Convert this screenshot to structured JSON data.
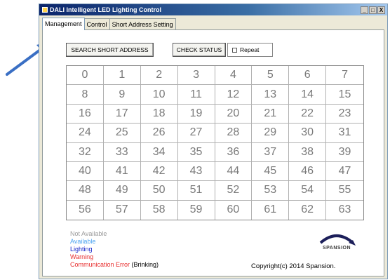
{
  "window": {
    "title": "DALI Intelligent LED Lighting Control",
    "controls": [
      "_",
      "□",
      "X"
    ]
  },
  "tabs": [
    {
      "label": "Management",
      "active": true
    },
    {
      "label": "Control",
      "active": false
    },
    {
      "label": "Short Address Setting",
      "active": false
    }
  ],
  "toolbar": {
    "search_label": "SEARCH SHORT ADDRESS",
    "check_label": "CHECK STATUS",
    "repeat_label": "Repeat",
    "repeat_checked": false
  },
  "grid": {
    "cells": [
      "0",
      "1",
      "2",
      "3",
      "4",
      "5",
      "6",
      "7",
      "8",
      "9",
      "10",
      "11",
      "12",
      "13",
      "14",
      "15",
      "16",
      "17",
      "18",
      "19",
      "20",
      "21",
      "22",
      "23",
      "24",
      "25",
      "26",
      "27",
      "28",
      "29",
      "30",
      "31",
      "32",
      "33",
      "34",
      "35",
      "36",
      "37",
      "38",
      "39",
      "40",
      "41",
      "42",
      "43",
      "44",
      "45",
      "46",
      "47",
      "48",
      "49",
      "50",
      "51",
      "52",
      "53",
      "54",
      "55",
      "56",
      "57",
      "58",
      "59",
      "60",
      "61",
      "62",
      "63"
    ]
  },
  "legend": {
    "not_available": "Not Available",
    "available": "Available",
    "lighting": "Lighting",
    "warning": "Warning",
    "comm_error": "Communication Error",
    "comm_error_note": "(Brinking)"
  },
  "colors": {
    "not_available": "#9a9a9a",
    "available": "#4aa3f0",
    "lighting": "#1020c8",
    "warning": "#e83030",
    "comm_error": "#e83030",
    "arrow": "#3a6fc4"
  },
  "logo": {
    "text": "SPANSION"
  },
  "footer": {
    "copyright": "Copyright(c) 2014 Spansion."
  }
}
